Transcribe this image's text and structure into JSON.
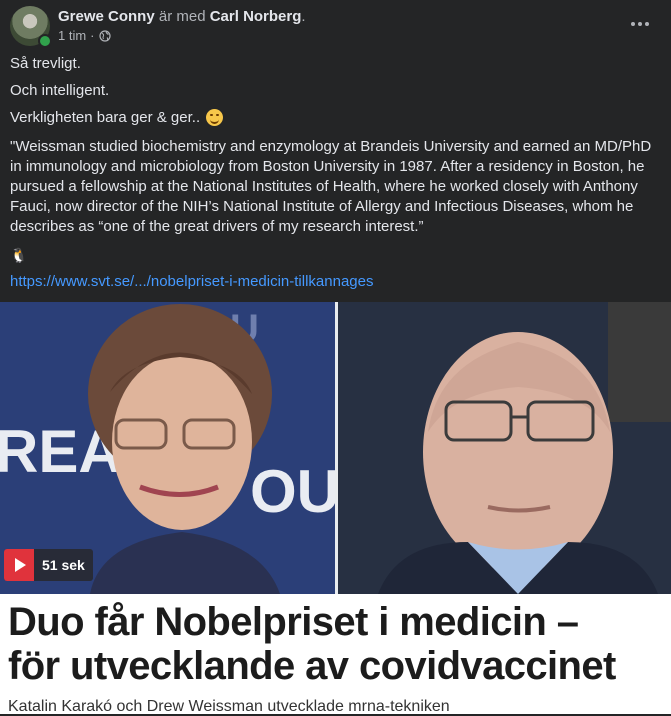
{
  "post": {
    "author": "Grewe Conny",
    "with_text": "är med",
    "tagged": "Carl Norberg",
    "period": ".",
    "time": "1 tim",
    "separator": "·",
    "privacy_icon": "globe-icon",
    "more_icon": "more-horizontal-icon"
  },
  "content": {
    "line1": "Så trevligt.",
    "line2": "Och intelligent.",
    "line3": "Verkligheten bara ger & ger..",
    "line3_emoji": "smiling-face-emoji",
    "quote": "\"Weissman studied biochemistry and enzymology at Brandeis University and earned an MD/PhD in immunology and microbiology from Boston University in 1987. After a residency in Boston, he pursued a fellowship at the National Institutes of Health, where he worked closely with Anthony Fauci, now director of the NIH’s National Institute of Allergy and Infectious Diseases, whom he describes as “one of the great drivers of my research interest.”",
    "emoji_line": "🐧",
    "link": "https://www.svt.se/.../nobelpriset-i-medicin-tillkannages"
  },
  "media": {
    "video_duration": "51 sek",
    "headline_line1": "Duo får Nobelpriset i medicin –",
    "headline_line2": "för utvecklande av covidvaccinet",
    "subheadline": "Katalin Karakó och Drew Weissman utvecklade mrna-tekniken"
  },
  "colors": {
    "background": "#242526",
    "text": "#e4e6eb",
    "secondary_text": "#b0b3b8",
    "link": "#4599ff",
    "online": "#31a24c",
    "video_badge": "#e0333c"
  }
}
